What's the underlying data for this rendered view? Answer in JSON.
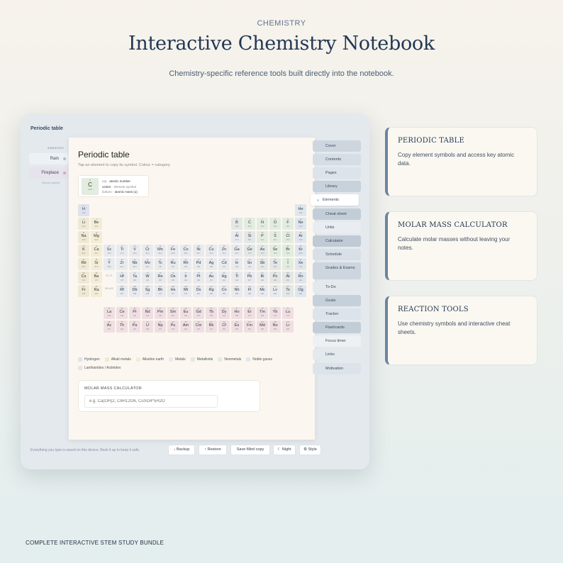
{
  "eyebrow": "CHEMISTRY",
  "title": "Interactive Chemistry Notebook",
  "subtitle": "Chemistry-specific reference tools built directly into the notebook.",
  "footer_tag": "COMPLETE INTERACTIVE STEM STUDY BUNDLE",
  "app": {
    "title": "Periodic table",
    "ambience_label": "AMBIENCE",
    "ambience": [
      {
        "label": "Rain"
      },
      {
        "label": "Fireplace"
      }
    ],
    "ambience_note": "Sounds optional",
    "save_note": "Everything you type is saved on this device. Back it up to keep it safe.",
    "toolbar": [
      "↓ Backup",
      "↑ Restore",
      "Save filled copy",
      "☾ Night",
      "⚙ Style"
    ]
  },
  "page": {
    "title": "Periodic table",
    "subtitle": "Tap an element to copy its symbol. Colour = category.",
    "key": {
      "n": "6",
      "s": "C",
      "m": "12.0",
      "top_a": "top · ",
      "top_b": "atomic number",
      "centre_a": "centre",
      "centre_b": " · element symbol",
      "bottom_a": "bottom · ",
      "bottom_b": "atomic mass (u)"
    },
    "lanthanides_placeholder": "57-71",
    "actinides_placeholder": "89-103",
    "legend": [
      {
        "label": "Hydrogen",
        "color": "#dde2ee"
      },
      {
        "label": "Alkali metals",
        "color": "#efe9d4"
      },
      {
        "label": "Alkaline earth",
        "color": "#f3ecd6"
      },
      {
        "label": "Metals",
        "color": "#e8eaee"
      },
      {
        "label": "Metalloids",
        "color": "#e3e7e6"
      },
      {
        "label": "Nonmetals",
        "color": "#e2ecdf"
      },
      {
        "label": "Noble gases",
        "color": "#e0e6ee"
      },
      {
        "label": "Lanthanides / Actinides",
        "color": "#f0dfe2"
      }
    ],
    "molar": {
      "label": "MOLAR MASS CALCULATOR",
      "placeholder": "e.g. Ca(OH)2, C6H12O6, CuSO4*5H2O"
    }
  },
  "nav": [
    "Cover",
    "Contents",
    "Pages",
    "Library",
    "Elements",
    "Cheat sheet",
    "Units",
    "Calculator",
    "Schedule",
    "Grades & Exams",
    "To-Do",
    "Goals",
    "Tracker",
    "Flashcards",
    "Focus timer",
    "Links",
    "Motivation"
  ],
  "nav_active": "Elements",
  "cards": [
    {
      "heading": "PERIODIC TABLE",
      "text": "Copy element symbols and access key atomic data."
    },
    {
      "heading": "MOLAR MASS CALCULATOR",
      "text": "Calculate molar masses without leaving your notes."
    },
    {
      "heading": "REACTION TOOLS",
      "text": "Use chemistry symbols and interactive cheat sheets."
    }
  ],
  "colors": {
    "hydrogen": "#dde2ee",
    "alkali": "#efe9d4",
    "alkaline": "#f3ecd6",
    "metal": "#e8eaee",
    "metalloid": "#e3e7e6",
    "nonmetal": "#e2ecdf",
    "noble": "#e0e6ee",
    "lanact": "#f0dfe2",
    "accent": "#6c84a1"
  },
  "elements": [
    [
      "1",
      "H",
      "1.01",
      1,
      1,
      "hydrogen"
    ],
    [
      "2",
      "He",
      "4.00",
      1,
      18,
      "noble"
    ],
    [
      "3",
      "Li",
      "6.94",
      2,
      1,
      "alkali"
    ],
    [
      "4",
      "Be",
      "9.01",
      2,
      2,
      "alkaline"
    ],
    [
      "5",
      "B",
      "10.8",
      2,
      13,
      "metalloid"
    ],
    [
      "6",
      "C",
      "12.0",
      2,
      14,
      "nonmetal"
    ],
    [
      "7",
      "N",
      "14.0",
      2,
      15,
      "nonmetal"
    ],
    [
      "8",
      "O",
      "16.0",
      2,
      16,
      "nonmetal"
    ],
    [
      "9",
      "F",
      "19.0",
      2,
      17,
      "nonmetal"
    ],
    [
      "10",
      "Ne",
      "20.2",
      2,
      18,
      "noble"
    ],
    [
      "11",
      "Na",
      "23.0",
      3,
      1,
      "alkali"
    ],
    [
      "12",
      "Mg",
      "24.3",
      3,
      2,
      "alkaline"
    ],
    [
      "13",
      "Al",
      "27.0",
      3,
      13,
      "metal"
    ],
    [
      "14",
      "Si",
      "28.1",
      3,
      14,
      "metalloid"
    ],
    [
      "15",
      "P",
      "31.0",
      3,
      15,
      "nonmetal"
    ],
    [
      "16",
      "S",
      "32.1",
      3,
      16,
      "nonmetal"
    ],
    [
      "17",
      "Cl",
      "35.5",
      3,
      17,
      "nonmetal"
    ],
    [
      "18",
      "Ar",
      "39.9",
      3,
      18,
      "noble"
    ],
    [
      "19",
      "K",
      "39.1",
      4,
      1,
      "alkali"
    ],
    [
      "20",
      "Ca",
      "40.1",
      4,
      2,
      "alkaline"
    ],
    [
      "21",
      "Sc",
      "45.0",
      4,
      3,
      "metal"
    ],
    [
      "22",
      "Ti",
      "47.9",
      4,
      4,
      "metal"
    ],
    [
      "23",
      "V",
      "50.9",
      4,
      5,
      "metal"
    ],
    [
      "24",
      "Cr",
      "52.0",
      4,
      6,
      "metal"
    ],
    [
      "25",
      "Mn",
      "54.9",
      4,
      7,
      "metal"
    ],
    [
      "26",
      "Fe",
      "55.8",
      4,
      8,
      "metal"
    ],
    [
      "27",
      "Co",
      "58.9",
      4,
      9,
      "metal"
    ],
    [
      "28",
      "Ni",
      "58.7",
      4,
      10,
      "metal"
    ],
    [
      "29",
      "Cu",
      "63.5",
      4,
      11,
      "metal"
    ],
    [
      "30",
      "Zn",
      "65.4",
      4,
      12,
      "metal"
    ],
    [
      "31",
      "Ga",
      "69.7",
      4,
      13,
      "metal"
    ],
    [
      "32",
      "Ge",
      "72.6",
      4,
      14,
      "metalloid"
    ],
    [
      "33",
      "As",
      "74.9",
      4,
      15,
      "metalloid"
    ],
    [
      "34",
      "Se",
      "79.0",
      4,
      16,
      "nonmetal"
    ],
    [
      "35",
      "Br",
      "79.9",
      4,
      17,
      "nonmetal"
    ],
    [
      "36",
      "Kr",
      "83.8",
      4,
      18,
      "noble"
    ],
    [
      "37",
      "Rb",
      "85.5",
      5,
      1,
      "alkali"
    ],
    [
      "38",
      "Sr",
      "87.6",
      5,
      2,
      "alkaline"
    ],
    [
      "39",
      "Y",
      "88.9",
      5,
      3,
      "metal"
    ],
    [
      "40",
      "Zr",
      "91.2",
      5,
      4,
      "metal"
    ],
    [
      "41",
      "Nb",
      "92.9",
      5,
      5,
      "metal"
    ],
    [
      "42",
      "Mo",
      "96.0",
      5,
      6,
      "metal"
    ],
    [
      "43",
      "Tc",
      "98",
      5,
      7,
      "metal"
    ],
    [
      "44",
      "Ru",
      "101",
      5,
      8,
      "metal"
    ],
    [
      "45",
      "Rh",
      "103",
      5,
      9,
      "metal"
    ],
    [
      "46",
      "Pd",
      "106",
      5,
      10,
      "metal"
    ],
    [
      "47",
      "Ag",
      "108",
      5,
      11,
      "metal"
    ],
    [
      "48",
      "Cd",
      "112",
      5,
      12,
      "metal"
    ],
    [
      "49",
      "In",
      "115",
      5,
      13,
      "metal"
    ],
    [
      "50",
      "Sn",
      "119",
      5,
      14,
      "metal"
    ],
    [
      "51",
      "Sb",
      "122",
      5,
      15,
      "metalloid"
    ],
    [
      "52",
      "Te",
      "128",
      5,
      16,
      "metalloid"
    ],
    [
      "53",
      "I",
      "127",
      5,
      17,
      "nonmetal"
    ],
    [
      "54",
      "Xe",
      "131",
      5,
      18,
      "noble"
    ],
    [
      "55",
      "Cs",
      "133",
      6,
      1,
      "alkali"
    ],
    [
      "56",
      "Ba",
      "137",
      6,
      2,
      "alkaline"
    ],
    [
      "72",
      "Hf",
      "178",
      6,
      4,
      "metal"
    ],
    [
      "73",
      "Ta",
      "181",
      6,
      5,
      "metal"
    ],
    [
      "74",
      "W",
      "184",
      6,
      6,
      "metal"
    ],
    [
      "75",
      "Re",
      "186",
      6,
      7,
      "metal"
    ],
    [
      "76",
      "Os",
      "190",
      6,
      8,
      "metal"
    ],
    [
      "77",
      "Ir",
      "192",
      6,
      9,
      "metal"
    ],
    [
      "78",
      "Pt",
      "195",
      6,
      10,
      "metal"
    ],
    [
      "79",
      "Au",
      "197",
      6,
      11,
      "metal"
    ],
    [
      "80",
      "Hg",
      "201",
      6,
      12,
      "metal"
    ],
    [
      "81",
      "Tl",
      "204",
      6,
      13,
      "metal"
    ],
    [
      "82",
      "Pb",
      "207",
      6,
      14,
      "metal"
    ],
    [
      "83",
      "Bi",
      "209",
      6,
      15,
      "metal"
    ],
    [
      "84",
      "Po",
      "209",
      6,
      16,
      "metalloid"
    ],
    [
      "85",
      "At",
      "210",
      6,
      17,
      "metalloid"
    ],
    [
      "86",
      "Rn",
      "222",
      6,
      18,
      "noble"
    ],
    [
      "87",
      "Fr",
      "223",
      7,
      1,
      "alkali"
    ],
    [
      "88",
      "Ra",
      "226",
      7,
      2,
      "alkaline"
    ],
    [
      "104",
      "Rf",
      "267",
      7,
      4,
      "metal"
    ],
    [
      "105",
      "Db",
      "268",
      7,
      5,
      "metal"
    ],
    [
      "106",
      "Sg",
      "269",
      7,
      6,
      "metal"
    ],
    [
      "107",
      "Bh",
      "270",
      7,
      7,
      "metal"
    ],
    [
      "108",
      "Hs",
      "277",
      7,
      8,
      "metal"
    ],
    [
      "109",
      "Mt",
      "278",
      7,
      9,
      "metal"
    ],
    [
      "110",
      "Ds",
      "281",
      7,
      10,
      "metal"
    ],
    [
      "111",
      "Rg",
      "282",
      7,
      11,
      "metal"
    ],
    [
      "112",
      "Cn",
      "285",
      7,
      12,
      "metal"
    ],
    [
      "113",
      "Nh",
      "286",
      7,
      13,
      "metal"
    ],
    [
      "114",
      "Fl",
      "289",
      7,
      14,
      "metal"
    ],
    [
      "115",
      "Mc",
      "290",
      7,
      15,
      "metal"
    ],
    [
      "116",
      "Lv",
      "293",
      7,
      16,
      "metal"
    ],
    [
      "117",
      "Ts",
      "294",
      7,
      17,
      "metalloid"
    ],
    [
      "118",
      "Og",
      "294",
      7,
      18,
      "noble"
    ],
    [
      "57",
      "La",
      "139",
      9,
      3,
      "lanact"
    ],
    [
      "58",
      "Ce",
      "140",
      9,
      4,
      "lanact"
    ],
    [
      "59",
      "Pr",
      "141",
      9,
      5,
      "lanact"
    ],
    [
      "60",
      "Nd",
      "144",
      9,
      6,
      "lanact"
    ],
    [
      "61",
      "Pm",
      "145",
      9,
      7,
      "lanact"
    ],
    [
      "62",
      "Sm",
      "150",
      9,
      8,
      "lanact"
    ],
    [
      "63",
      "Eu",
      "152",
      9,
      9,
      "lanact"
    ],
    [
      "64",
      "Gd",
      "157",
      9,
      10,
      "lanact"
    ],
    [
      "65",
      "Tb",
      "159",
      9,
      11,
      "lanact"
    ],
    [
      "66",
      "Dy",
      "163",
      9,
      12,
      "lanact"
    ],
    [
      "67",
      "Ho",
      "165",
      9,
      13,
      "lanact"
    ],
    [
      "68",
      "Er",
      "167",
      9,
      14,
      "lanact"
    ],
    [
      "69",
      "Tm",
      "169",
      9,
      15,
      "lanact"
    ],
    [
      "70",
      "Yb",
      "173",
      9,
      16,
      "lanact"
    ],
    [
      "71",
      "Lu",
      "175",
      9,
      17,
      "lanact"
    ],
    [
      "89",
      "Ac",
      "227",
      10,
      3,
      "lanact"
    ],
    [
      "90",
      "Th",
      "232",
      10,
      4,
      "lanact"
    ],
    [
      "91",
      "Pa",
      "231",
      10,
      5,
      "lanact"
    ],
    [
      "92",
      "U",
      "238",
      10,
      6,
      "lanact"
    ],
    [
      "93",
      "Np",
      "237",
      10,
      7,
      "lanact"
    ],
    [
      "94",
      "Pu",
      "244",
      10,
      8,
      "lanact"
    ],
    [
      "95",
      "Am",
      "243",
      10,
      9,
      "lanact"
    ],
    [
      "96",
      "Cm",
      "247",
      10,
      10,
      "lanact"
    ],
    [
      "97",
      "Bk",
      "247",
      10,
      11,
      "lanact"
    ],
    [
      "98",
      "Cf",
      "251",
      10,
      12,
      "lanact"
    ],
    [
      "99",
      "Es",
      "252",
      10,
      13,
      "lanact"
    ],
    [
      "100",
      "Fm",
      "257",
      10,
      14,
      "lanact"
    ],
    [
      "101",
      "Md",
      "258",
      10,
      15,
      "lanact"
    ],
    [
      "102",
      "No",
      "259",
      10,
      16,
      "lanact"
    ],
    [
      "103",
      "Lr",
      "266",
      10,
      17,
      "lanact"
    ]
  ]
}
